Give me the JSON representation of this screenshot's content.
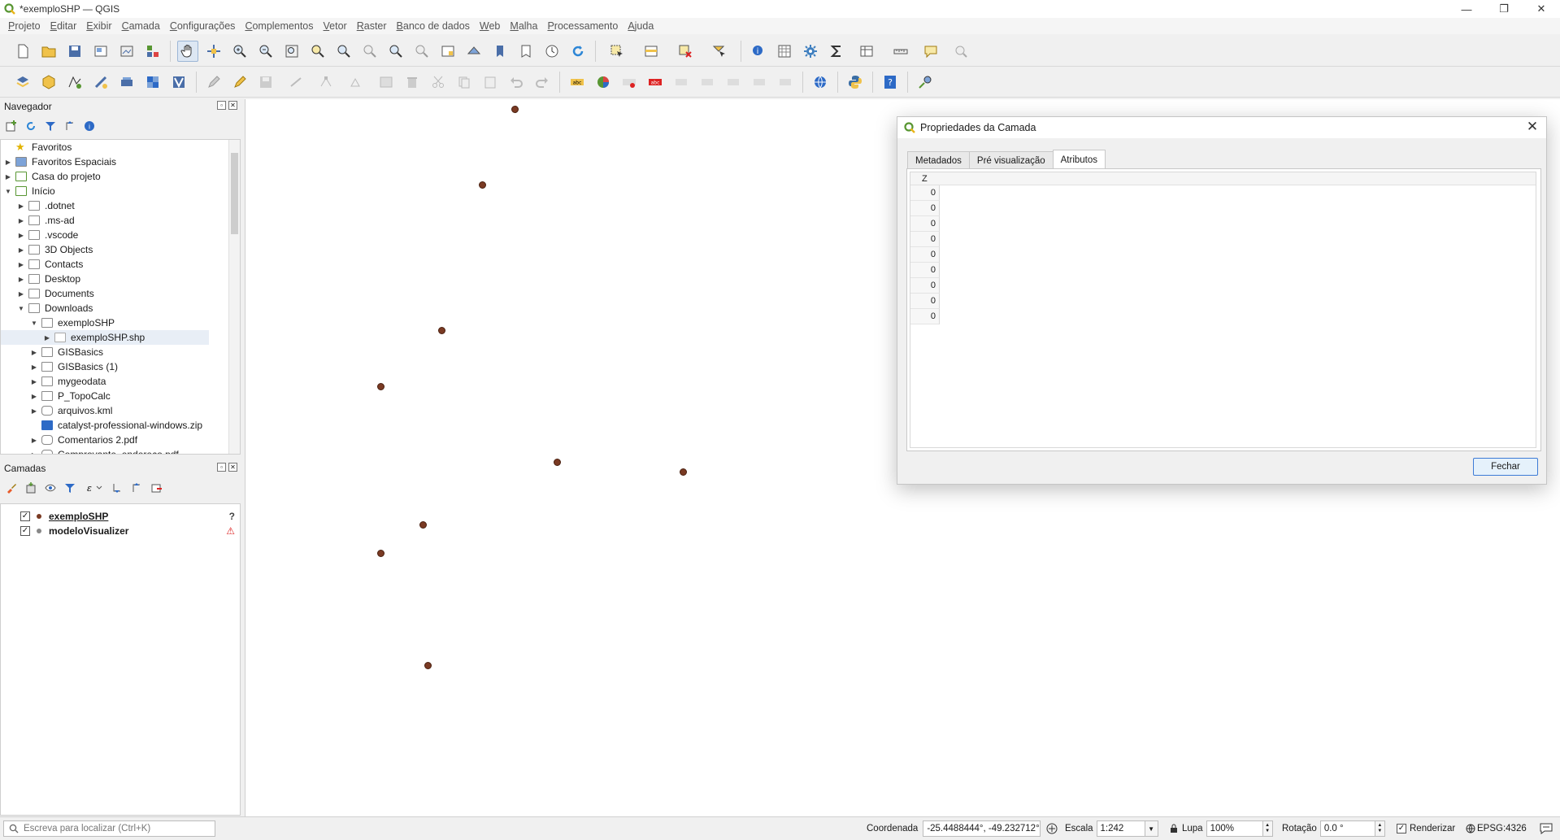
{
  "window": {
    "title": "*exemploSHP — QGIS",
    "minimize_glyph": "—",
    "maximize_glyph": "❐",
    "close_glyph": "✕"
  },
  "menu": [
    "Projeto",
    "Editar",
    "Exibir",
    "Camada",
    "Configurações",
    "Complementos",
    "Vetor",
    "Raster",
    "Banco de dados",
    "Web",
    "Malha",
    "Processamento",
    "Ajuda"
  ],
  "colors": {
    "accent": "#3d7bd6",
    "point_fill": "#7a3a23",
    "qgis_green": "#589632",
    "folder": "#f0c24a"
  },
  "navigator": {
    "title": "Navegador",
    "items": [
      {
        "label": "Favoritos",
        "level": 0,
        "expand": "",
        "icon": "star"
      },
      {
        "label": "Favoritos Espaciais",
        "level": 0,
        "expand": "▶",
        "icon": "spatial"
      },
      {
        "label": "Casa do projeto",
        "level": 0,
        "expand": "▶",
        "icon": "home"
      },
      {
        "label": "Início",
        "level": 0,
        "expand": "▼",
        "icon": "home"
      },
      {
        "label": ".dotnet",
        "level": 1,
        "expand": "▶",
        "icon": "folder"
      },
      {
        "label": ".ms-ad",
        "level": 1,
        "expand": "▶",
        "icon": "folder"
      },
      {
        "label": ".vscode",
        "level": 1,
        "expand": "▶",
        "icon": "folder"
      },
      {
        "label": "3D Objects",
        "level": 1,
        "expand": "▶",
        "icon": "folder"
      },
      {
        "label": "Contacts",
        "level": 1,
        "expand": "▶",
        "icon": "folder"
      },
      {
        "label": "Desktop",
        "level": 1,
        "expand": "▶",
        "icon": "folder"
      },
      {
        "label": "Documents",
        "level": 1,
        "expand": "▶",
        "icon": "folder"
      },
      {
        "label": "Downloads",
        "level": 1,
        "expand": "▼",
        "icon": "folder"
      },
      {
        "label": "exemploSHP",
        "level": 2,
        "expand": "▼",
        "icon": "folder"
      },
      {
        "label": "exemploSHP.shp",
        "level": 3,
        "expand": "▶",
        "icon": "vector",
        "selected": true
      },
      {
        "label": "GISBasics",
        "level": 2,
        "expand": "▶",
        "icon": "folder"
      },
      {
        "label": "GISBasics (1)",
        "level": 2,
        "expand": "▶",
        "icon": "folder"
      },
      {
        "label": "mygeodata",
        "level": 2,
        "expand": "▶",
        "icon": "folder"
      },
      {
        "label": "P_TopoCalc",
        "level": 2,
        "expand": "▶",
        "icon": "folder"
      },
      {
        "label": "arquivos.kml",
        "level": 2,
        "expand": "▶",
        "icon": "db"
      },
      {
        "label": "catalyst-professional-windows.zip",
        "level": 2,
        "expand": "",
        "icon": "zip"
      },
      {
        "label": "Comentarios 2.pdf",
        "level": 2,
        "expand": "▶",
        "icon": "db"
      },
      {
        "label": "Comprovante_endereco.pdf",
        "level": 2,
        "expand": "▶",
        "icon": "db"
      }
    ]
  },
  "layers": {
    "title": "Camadas",
    "items": [
      {
        "label": "exemploSHP",
        "checked": "✓",
        "color": "#7a3a23",
        "status": "?"
      },
      {
        "label": "modeloVisualizer",
        "checked": "✓",
        "color": "#888888",
        "status": "⚠"
      }
    ]
  },
  "dialog": {
    "title": "Propriedades da Camada",
    "tabs": [
      "Metadados",
      "Pré visualização",
      "Atributos"
    ],
    "active_tab": "Atributos",
    "column": "Z",
    "values": [
      "0",
      "0",
      "0",
      "0",
      "0",
      "0",
      "0",
      "0",
      "0"
    ],
    "close_button": "Fechar"
  },
  "map_points": [
    {
      "lon": 0.205,
      "lat": 0.986
    },
    {
      "lon": 0.18,
      "lat": 0.88
    },
    {
      "lon": 0.149,
      "lat": 0.678
    },
    {
      "lon": 0.103,
      "lat": 0.599
    },
    {
      "lon": 0.237,
      "lat": 0.494
    },
    {
      "lon": 0.333,
      "lat": 0.48
    },
    {
      "lon": 0.135,
      "lat": 0.407
    },
    {
      "lon": 0.103,
      "lat": 0.367
    },
    {
      "lon": 0.139,
      "lat": 0.21
    }
  ],
  "statusbar": {
    "search_placeholder": "Escreva para localizar (Ctrl+K)",
    "coord_label": "Coordenada",
    "coord_value": "-25.4488444°, -49.232712°",
    "scale_label": "Escala",
    "scale_value": "1:242",
    "magnifier_label": "Lupa",
    "magnifier_value": "100%",
    "rotation_label": "Rotação",
    "rotation_value": "0.0 °",
    "render_label": "Renderizar",
    "render_checked": "✓",
    "crs": "EPSG:4326"
  }
}
